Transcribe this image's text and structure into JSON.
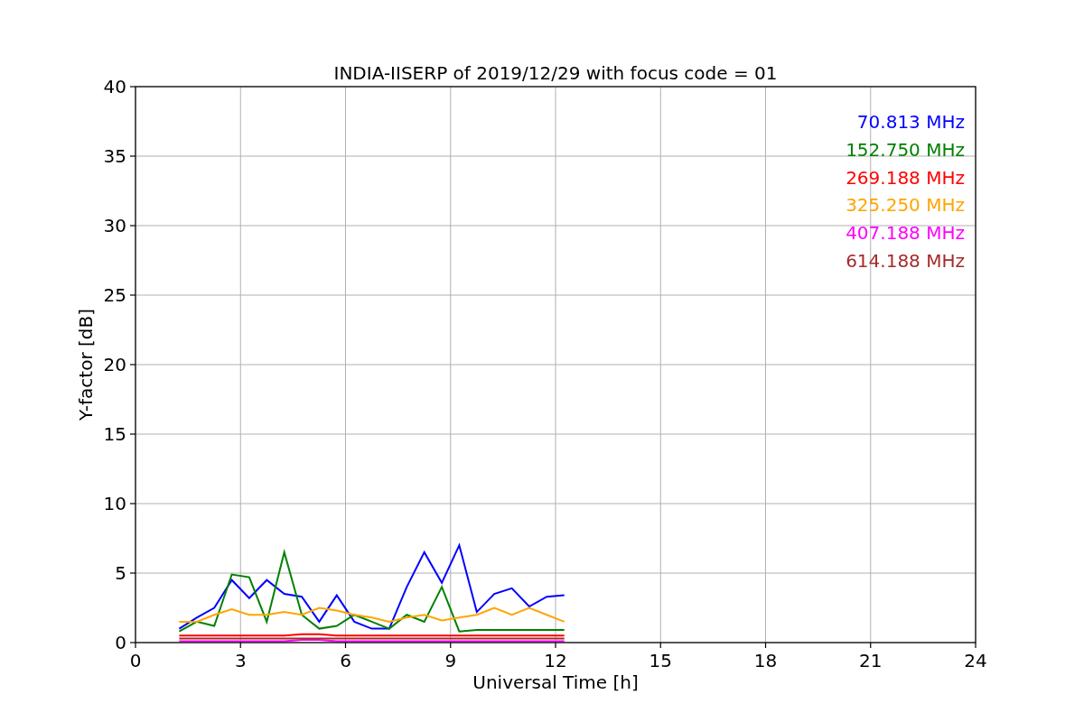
{
  "chart_data": {
    "type": "line",
    "grid": true,
    "title": "INDIA-IISERP of 2019/12/29 with focus code = 01",
    "xlabel": "Universal Time [h]",
    "ylabel": "Y-factor [dB]",
    "xlim": [
      0,
      24
    ],
    "ylim": [
      0,
      40
    ],
    "xticks": [
      0,
      3,
      6,
      9,
      12,
      15,
      18,
      21,
      24
    ],
    "yticks": [
      0,
      5,
      10,
      15,
      20,
      25,
      30,
      35,
      40
    ],
    "x": [
      1.25,
      1.75,
      2.25,
      2.75,
      3.25,
      3.75,
      4.25,
      4.75,
      5.25,
      5.75,
      6.25,
      6.75,
      7.25,
      7.75,
      8.25,
      8.75,
      9.25,
      9.75,
      10.25,
      10.75,
      11.25,
      11.75,
      12.25
    ],
    "series": [
      {
        "name": "70.813 MHz",
        "color": "#0000ff",
        "values": [
          1.0,
          1.8,
          2.5,
          4.5,
          3.2,
          4.5,
          3.5,
          3.3,
          1.5,
          3.4,
          1.5,
          1.0,
          1.0,
          4.0,
          6.5,
          4.3,
          7.0,
          2.2,
          3.5,
          3.9,
          2.6,
          3.3,
          3.4
        ]
      },
      {
        "name": "152.750 MHz",
        "color": "#008000",
        "values": [
          0.8,
          1.5,
          1.2,
          4.9,
          4.7,
          1.5,
          6.5,
          2.0,
          1.0,
          1.2,
          2.0,
          1.5,
          1.0,
          2.0,
          1.5,
          4.0,
          0.8,
          0.9,
          0.9,
          0.9,
          0.9,
          0.9,
          0.9
        ]
      },
      {
        "name": "269.188 MHz",
        "color": "#ff0000",
        "values": [
          0.5,
          0.5,
          0.5,
          0.5,
          0.5,
          0.5,
          0.5,
          0.6,
          0.6,
          0.5,
          0.5,
          0.5,
          0.5,
          0.5,
          0.5,
          0.5,
          0.5,
          0.5,
          0.5,
          0.5,
          0.5,
          0.5,
          0.5
        ]
      },
      {
        "name": "325.250 MHz",
        "color": "#ffa500",
        "values": [
          1.5,
          1.5,
          2.0,
          2.4,
          2.0,
          2.0,
          2.2,
          2.0,
          2.5,
          2.3,
          2.0,
          1.8,
          1.5,
          1.8,
          2.0,
          1.6,
          1.8,
          2.0,
          2.5,
          2.0,
          2.5,
          2.0,
          1.5
        ]
      },
      {
        "name": "407.188 MHz",
        "color": "#ff00ff",
        "values": [
          0.1,
          0.1,
          0.1,
          0.1,
          0.1,
          0.1,
          0.1,
          0.2,
          0.2,
          0.1,
          0.1,
          0.1,
          0.1,
          0.1,
          0.1,
          0.1,
          0.1,
          0.1,
          0.1,
          0.1,
          0.1,
          0.1,
          0.1
        ]
      },
      {
        "name": "614.188 MHz",
        "color": "#a52a2a",
        "values": [
          0.3,
          0.3,
          0.3,
          0.3,
          0.3,
          0.3,
          0.3,
          0.3,
          0.3,
          0.3,
          0.3,
          0.3,
          0.3,
          0.3,
          0.3,
          0.3,
          0.3,
          0.3,
          0.3,
          0.3,
          0.3,
          0.3,
          0.3
        ]
      }
    ]
  }
}
